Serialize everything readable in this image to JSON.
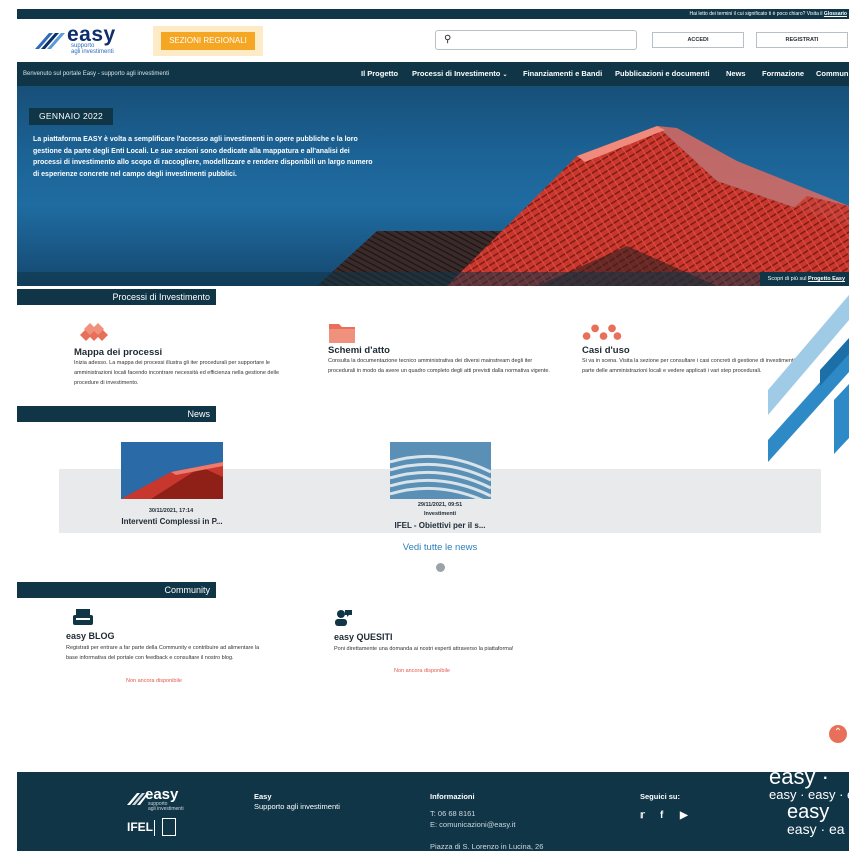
{
  "topbar": {
    "text": "Hai letto dei termini il cui significato ti è poco chiaro? Visita il ",
    "link": "Glossario"
  },
  "header": {
    "logo_word": "easy",
    "logo_sub1": "supporto",
    "logo_sub2": "agli investimenti",
    "regional_button": "Sezioni regionali",
    "search_placeholder": "",
    "login": "Accedi",
    "register": "Registrati"
  },
  "nav": {
    "welcome": "Benvenuto sul portale Easy - supporto agli investimenti",
    "items": [
      "Il Progetto",
      "Processi di Investimento",
      "Finanziamenti e Bandi",
      "Pubblicazioni e documenti",
      "News",
      "Formazione",
      "Community"
    ]
  },
  "hero": {
    "badge": "GENNAIO 2022",
    "text": "La piattaforma EASY è volta a semplificare l'accesso agli investimenti in opere pubbliche e la loro gestione da parte degli Enti Locali. Le sue sezioni sono dedicate alla mappatura e all'analisi dei processi di investimento allo scopo di raccogliere, modellizzare e rendere disponibili un largo numero di esperienze concrete nel campo degli investimenti pubblici.",
    "more_text": "Scopri di più sul ",
    "more_link": "Progetto Easy"
  },
  "processi": {
    "heading": "Processi di Investimento",
    "cards": [
      {
        "title": "Mappa dei processi",
        "text": "Inizia adesso. La mappa dei processi illustra gli iter procedurali per supportare le amministrazioni locali facendo incontrare necessità ed efficienza nella gestione delle procedure di investimento."
      },
      {
        "title": "Schemi d'atto",
        "text": "Consulta la documentazione tecnico amministrativa dei diversi mainstream degli iter procedurali in modo da avere un quadro completo degli atti previsti dalla normativa vigente."
      },
      {
        "title": "Casi d'uso",
        "text": "Si va in scena. Visita la sezione per consultare i casi concreti di gestione di investimenti da parte delle amministrazioni locali e vedere applicati i vari step procedurali."
      }
    ]
  },
  "news": {
    "heading": "News",
    "items": [
      {
        "date": "30/11/2021, 17:14",
        "category": "",
        "title": "Interventi Complessi in P..."
      },
      {
        "date": "29/11/2021, 09:51",
        "category": "Investimenti",
        "title": "IFEL - Obiettivi per il s..."
      }
    ],
    "see_all": "Vedi tutte le news"
  },
  "community": {
    "heading": "Community",
    "blog": {
      "title": "easy BLOG",
      "text": "Registrati per entrare a far parte della Community e contribuire ad alimentare la base informativa del portale con feedback e consultare il nostro blog.",
      "status": "Non ancora disponibile"
    },
    "quesiti": {
      "title": "easy QUESITI",
      "text": "Poni direttamente una domanda ai nostri esperti attraverso la piattaforma!",
      "status": "Non ancora disponibile"
    }
  },
  "footer": {
    "logo_word": "easy",
    "logo_sub1": "supporto",
    "logo_sub2": "agli investimenti",
    "ifel": "IFEL",
    "col1_title": "Easy",
    "col1_text": "Supporto agli investimenti",
    "info_title": "Informazioni",
    "phone": "T: 06 68 8161",
    "email": "E: comunicazioni@easy.it",
    "address": "Piazza di S. Lorenzo in Lucina, 26",
    "social_title": "Seguici su:",
    "social": [
      "twitter-icon",
      "facebook-icon",
      "youtube-icon"
    ],
    "wall": [
      "easy ·",
      "easy · easy · e",
      "easy",
      "easy · ea"
    ]
  },
  "colors": {
    "primary_dark": "#0f3547",
    "accent_orange": "#f5a623",
    "accent_red": "#e8705a",
    "link_blue": "#2e7fb8"
  }
}
